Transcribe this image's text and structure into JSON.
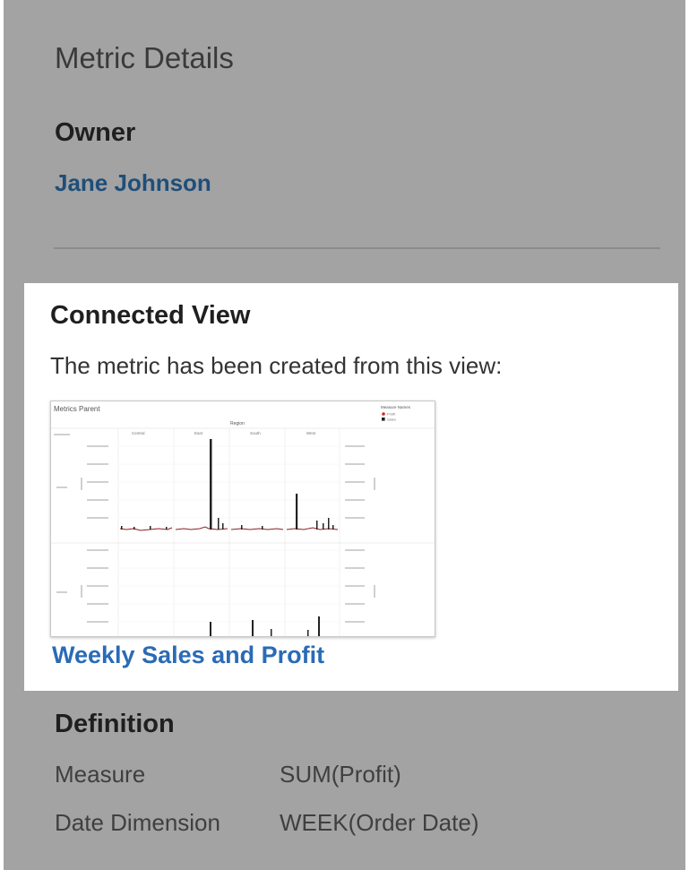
{
  "panel": {
    "title": "Metric Details"
  },
  "owner": {
    "heading": "Owner",
    "name": "Jane Johnson"
  },
  "connected_view": {
    "heading": "Connected View",
    "description": "The metric has been created from this view:",
    "link_label": "Weekly Sales and Profit",
    "thumbnail": {
      "title": "Metrics Parent",
      "column_header": "Region",
      "regions": [
        "Central",
        "East",
        "South",
        "West"
      ],
      "legend_title": "Measure Names",
      "legend_items": [
        "Profit",
        "Sales"
      ]
    }
  },
  "definition": {
    "heading": "Definition",
    "rows": [
      {
        "label": "Measure",
        "value": "SUM(Profit)"
      },
      {
        "label": "Date Dimension",
        "value": "WEEK(Order Date)"
      }
    ]
  },
  "colors": {
    "overlay_gray": "#a3a3a3",
    "link_dark": "#1f4e79",
    "link_blue": "#2a6bb5",
    "profit_red": "#d62728",
    "sales_black": "#222222"
  }
}
